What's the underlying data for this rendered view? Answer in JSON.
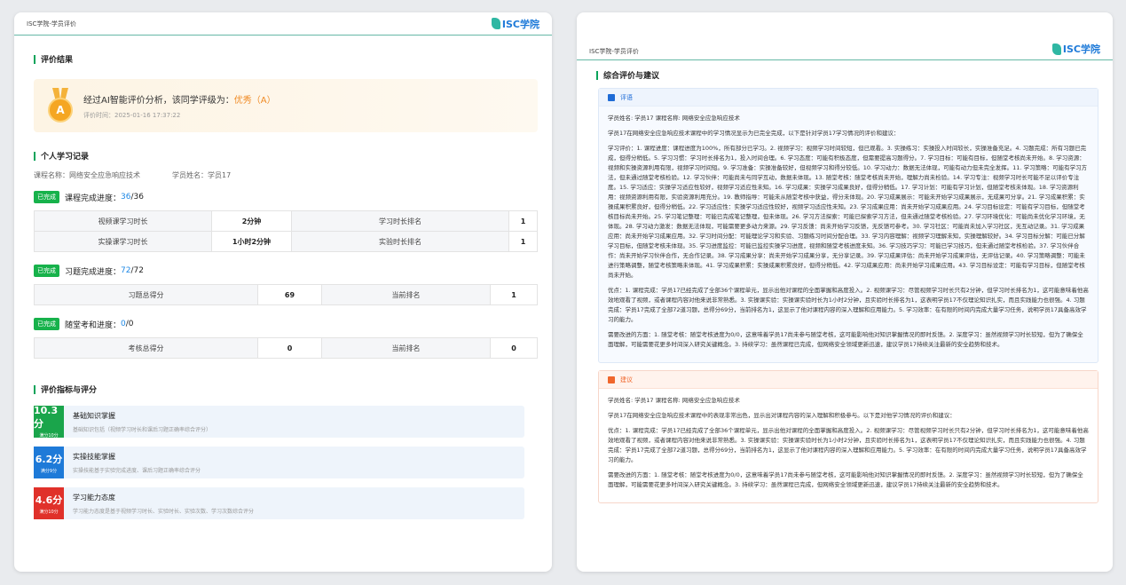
{
  "left": {
    "header": "ISC学院-学员评价",
    "logo": "ISC学院",
    "eval_title": "评价结果",
    "eval_text": "经过AI智能评价分析，该同学评级为：",
    "eval_grade": "优秀（A）",
    "eval_time": "评价时间：2025-01-16 17:37:22",
    "medal": "A",
    "record_title": "个人学习记录",
    "course": "课程名称：网络安全应急响应技术",
    "student": "学员姓名：学员17",
    "course_prog": {
      "badge": "已完成",
      "label": "课程完成进度：",
      "done": "36",
      "total": "/36"
    },
    "course_rows": [
      [
        "视频课学习时长",
        "2分钟",
        "学习时长排名",
        "1"
      ],
      [
        "实操课学习时长",
        "1小时2分钟",
        "实验时长排名",
        "1"
      ]
    ],
    "exercise_prog": {
      "badge": "已完成",
      "label": "习题完成进度：",
      "done": "72",
      "total": "/72"
    },
    "exercise_row": [
      "习题总得分",
      "69",
      "当前排名",
      "1"
    ],
    "exam_prog": {
      "badge": "已完成",
      "label": "随堂考和进度：",
      "done": "0",
      "total": "/0"
    },
    "exam_row": [
      "考核总得分",
      "0",
      "当前排名",
      "0"
    ],
    "ind_title": "评价指标与评分",
    "indicators": [
      {
        "score": "10.3分",
        "full": "满分10分",
        "title": "基础知识掌握",
        "desc": "基础知识包括（视频学习时长和课后习题正确率综合评分）",
        "color": "#1aa54b"
      },
      {
        "score": "6.2分",
        "full": "满分9分",
        "title": "实操技能掌握",
        "desc": "实操技能基于实验完成进度、课后习题正确率综合评分",
        "color": "#1e7ad8"
      },
      {
        "score": "4.6分",
        "full": "满分10分",
        "title": "学习能力态度",
        "desc": "学习能力态度是基于视频学习时长、实验时长、实验次数、学习次数综合评分",
        "color": "#e0312a"
      }
    ]
  },
  "right": {
    "header": "ISC学院-学员评价",
    "logo": "ISC学院",
    "title": "综合评价与建议",
    "box1": "评语",
    "box2": "建议",
    "info": "学员姓名: 学员17 课程名称: 网络安全应急响应技术",
    "intro1": "学员17在网络安全应急响应技术课程中的学习情况显示为已完全完成，以下是针对学员17学习情况的评价和建议：",
    "eval_long": "学习评价：1. 课程进度：课程进度为100%，所有部分已学习。2. 视频学习：视频学习时间较短，但已观看。3. 实操练习：实操投入时间较长，实操准备充足。4. 习题完成：所有习题已完成，但得分稍低。5. 学习习惯：学习时长排名为1，投入时间合理。6. 学习态度：可能有积极态度，但需要提高习题得分。7. 学习目标：可能有目标，但随堂考核尚未开始。8. 学习资源：视频和实操资源利用有限，视频学习时间短。9. 学习准备：实操准备较好，但视频学习和得分较低。10. 学习动力：数据无法体现，可能有动力但未完全发挥。11. 学习策略：可能有学习方法，但未通过随堂考核检验。12. 学习伙伴：可能尚未与同学互动，数据未体现。13. 随堂考核：随堂考核尚未开始，理解力尚未检验。14. 学习专注：视频学习时长可能不足以评价专注度。15. 学习适应：实操学习适应性较好，视频学习适应性未知。16. 学习成果：实操学习成果良好，但得分稍低。17. 学习计划：可能有学习计划，但随堂考核未体现。18. 学习资源利用：视频资源利用有限，实验资源利用充分。19. 教师指导：可能未从随堂考核中获益，得分未体现。20. 学习成果展示：可能未开始学习成果展示，无成果可分享。21. 学习成果积累：实操成果积累良好，但得分稍低。22. 学习适应性：实操学习适应性较好，视频学习适应性未知。23. 学习成果应用：尚未开始学习成果应用。24. 学习目标设定：可能有学习目标，但随堂考核目标尚未开始。25. 学习笔记整理：可能已完成笔记整理，但未体现。26. 学习方法探索：可能已探索学习方法，但未通过随堂考核检验。27. 学习环境优化：可能尚未优化学习环境，无体现。28. 学习动力激发：数据无法体现，可能需要更多动力来源。29. 学习反馈：尚未开始学习反馈，无反馈可参考。30. 学习社区：可能尚未加入学习社区，无互动记录。31. 学习成果应用：尚未开始学习成果应用。32. 学习时间分配：可能理论学习和实验、习题练习时间分配合理。33. 学习内容理解：视频学习理解未知，实操理解较好。34. 学习目标分解：可能已分解学习目标，但随堂考核未体现。35. 学习进度监控：可能已监控实操学习进度，视频和随堂考核进度未知。36. 学习技巧学习：可能已学习技巧，但未通过随堂考核检验。37. 学习伙伴合作：尚未开始学习伙伴合作，无合作记录。38. 学习成果分享：尚未开始学习成果分享，无分享记录。39. 学习成果评估：尚未开始学习成果评估，无评估记录。40. 学习策略调整：可能未进行策略调整，随堂考核策略未体现。41. 学习成果积累：实操成果积累良好，但得分稍低。42. 学习成果应用：尚未开始学习成果应用。43. 学习目标设定：可能有学习目标，但随堂考核尚未开始。",
    "strengths": "优点：1. 课程完成：学员17已经完成了全部36个课程单元，显示出他对课程的全面掌握和高度投入。2. 视频课学习：尽管视频学习时长只有2分钟，但学习时长排名为1，这可能意味着他高效地观看了视频，或者课程内容对他来说非常熟悉。3. 实操课实验：实操课实验时长为1小时2分钟，且实验时长排名为1，这表明学员17不仅理论知识扎实，而且实践能力也很强。4. 习题完成：学员17完成了全部72道习题，总得分69分，当前排名为1，这显示了他对课程内容的深入理解和应用能力。5. 学习效率：在有限的时间内完成大量学习任务，说明学员17具备高效学习的能力。",
    "improve": "需要改进的方面：1. 随堂考核：随堂考核进度为0/0，这意味着学员17尚未参与随堂考核，这可能影响他对知识掌握情况的即时反馈。2. 深度学习：虽然视频学习时长较短，但为了确保全面理解，可能需要花更多时间深入研究关键概念。3. 持续学习：虽然课程已完成，但网络安全领域更新迅速，建议学员17持续关注最新的安全趋势和技术。",
    "intro2": "学员17在网络安全应急响应技术课程中的表现非常出色，显示出对课程内容的深入理解和积极参与。以下是对他学习情况的评价和建议：",
    "strengths2": "优点：1. 课程完成：学员17已经完成了全部36个课程单元，显示出他对课程的全面掌握和高度投入。2. 视频课学习：尽管视频学习时长只有2分钟，但学习时长排名为1，这可能意味着他高效地观看了视频，或者课程内容对他来说非常熟悉。3. 实操课实验：实操课实验时长为1小时2分钟，且实验时长排名为1，这表明学员17不仅理论知识扎实，而且实践能力也很强。4. 习题完成：学员17完成了全部72道习题，总得分69分，当前排名为1，这显示了他对课程内容的深入理解和应用能力。5. 学习效率：在有限的时间内完成大量学习任务，说明学员17具备高效学习的能力。",
    "improve2": "需要改进的方面：1. 随堂考核：随堂考核进度为0/0，这意味着学员17尚未参与随堂考核，这可能影响他对知识掌握情况的即时反馈。2. 深度学习：虽然视频学习时长较短，但为了确保全面理解，可能需要花更多时间深入研究关键概念。3. 持续学习：虽然课程已完成，但网络安全领域更新迅速，建议学员17持续关注最新的安全趋势和技术。"
  }
}
